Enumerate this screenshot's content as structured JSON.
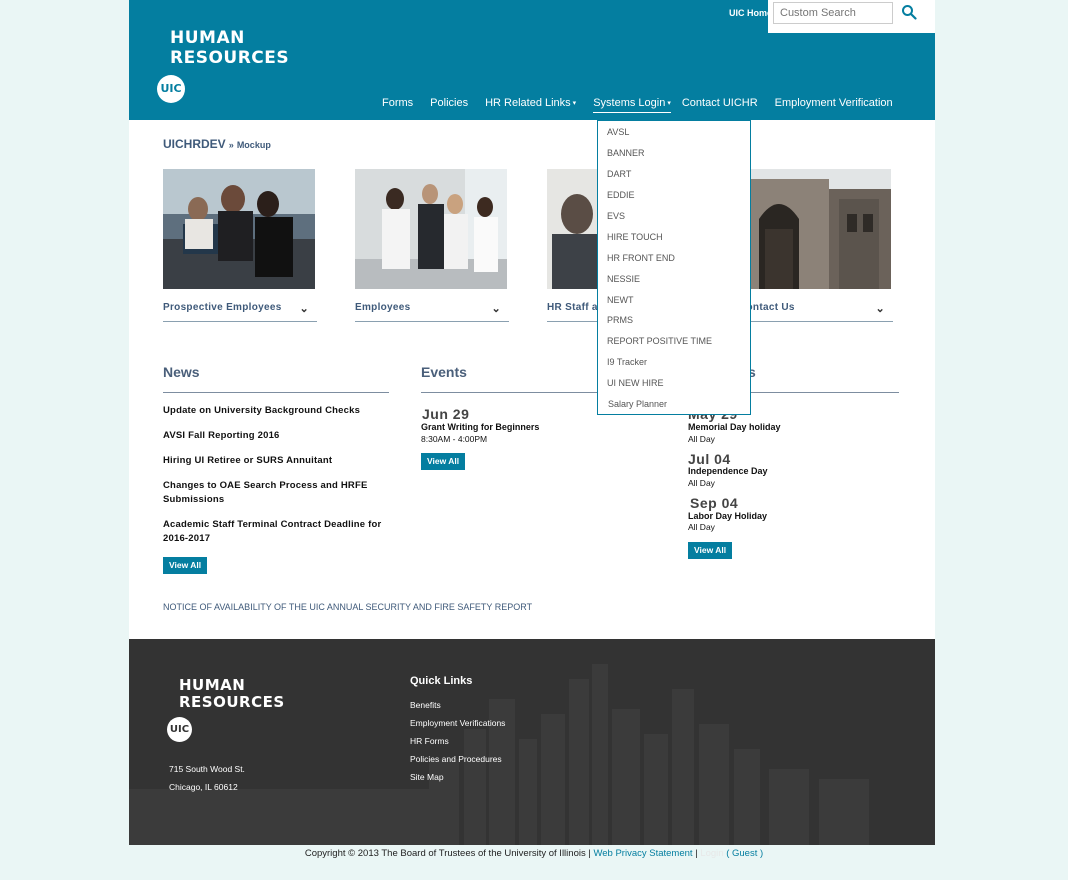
{
  "header": {
    "logo_line1": "HUMAN",
    "logo_line2": "RESOURCES",
    "badge": "UIC",
    "uic_home": "UIC Home",
    "search_placeholder": "Custom Search"
  },
  "nav": {
    "items": [
      {
        "label": "Forms"
      },
      {
        "label": "Policies"
      },
      {
        "label": "HR Related Links",
        "caret": "▾"
      },
      {
        "label": "Systems Login",
        "caret": "▾"
      },
      {
        "label": "Contact UICHR"
      },
      {
        "label": "Employment Verification"
      }
    ]
  },
  "systems_dropdown": {
    "items": [
      "AVSL",
      "BANNER",
      "DART",
      "EDDIE",
      "EVS",
      "HIRE TOUCH",
      "HR FRONT END",
      "NESSIE",
      "NEWT",
      "PRMS",
      "REPORT POSITIVE TIME",
      "I9 Tracker",
      "UI NEW HIRE",
      "Salary Planner"
    ]
  },
  "breadcrumb": {
    "home": "UICHRDEV",
    "sep": "»",
    "current": "Mockup"
  },
  "tiles": [
    {
      "label": "Prospective Employees"
    },
    {
      "label": "Employees"
    },
    {
      "label": "HR Staff a"
    },
    {
      "label": "Contact Us"
    }
  ],
  "news": {
    "title": "News",
    "items": [
      "Update on University Background Checks",
      "AVSI Fall Reporting 2016",
      "Hiring UI Retiree or SURS Annuitant",
      "Changes to OAE Search Process and HRFE Submissions",
      "Academic Staff Terminal Contract Deadline for 2016-2017"
    ],
    "view_all": "View All"
  },
  "events": {
    "title": "Events",
    "items": [
      {
        "date": "Jun 29",
        "title": "Grant Writing for Beginners",
        "time": "8:30AM - 4:00PM"
      }
    ],
    "view_all": "View All"
  },
  "holidays": {
    "title": "s",
    "items": [
      {
        "date": "May 29",
        "title": "Memorial Day holiday",
        "time": "All Day"
      },
      {
        "date": "Jul 04",
        "title": "Independence Day",
        "time": "All Day"
      },
      {
        "date": "Sep 04",
        "title": "Labor Day Holiday",
        "time": "All Day"
      }
    ],
    "view_all": "View All"
  },
  "notice": "NOTICE OF AVAILABILITY OF THE UIC ANNUAL SECURITY AND FIRE SAFETY REPORT",
  "footer": {
    "logo_line1": "HUMAN",
    "logo_line2": "RESOURCES",
    "badge": "UIC",
    "address_line1": "715 South Wood St.",
    "address_line2": "Chicago, IL 60612",
    "quick_links_title": "Quick Links",
    "quick_links": [
      "Benefits",
      "Employment Verifications",
      "HR Forms",
      "Policies and Procedures",
      "Site Map"
    ]
  },
  "copyright": {
    "text": "Copyright © 2013 The Board of Trustees of the University of Illinois |",
    "privacy": "Web Privacy Statement",
    "sep": "|",
    "login": "Login",
    "guest": "( Guest )"
  }
}
